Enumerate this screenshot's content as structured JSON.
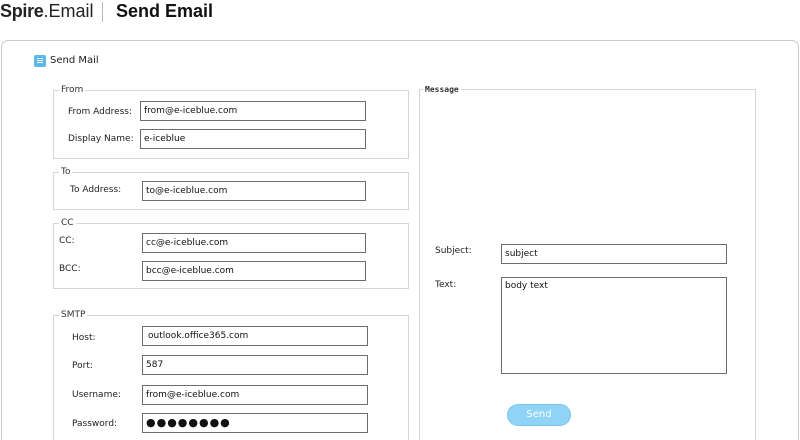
{
  "header": {
    "brand_strong": "Spire",
    "brand_suffix": ".Email",
    "title": "Send Email"
  },
  "panel": {
    "title": "Send Mail",
    "icon": "email-app-icon"
  },
  "from_group": {
    "legend": "From",
    "from_address_label": "From Address:",
    "from_address_value": "from@e-iceblue.com",
    "display_name_label": "Display Name:",
    "display_name_value": "e-iceblue"
  },
  "to_group": {
    "legend": "To",
    "to_address_label": "To Address:",
    "to_address_value": "to@e-iceblue.com"
  },
  "cc_group": {
    "legend": "CC",
    "cc_label": "CC:",
    "cc_value": "cc@e-iceblue.com",
    "bcc_label": "BCC:",
    "bcc_value": "bcc@e-iceblue.com"
  },
  "smtp_group": {
    "legend": "SMTP",
    "host_label": "Host:",
    "host_value": "outlook.office365.com",
    "port_label": "Port:",
    "port_value": "587",
    "username_label": "Username:",
    "username_value": "from@e-iceblue.com",
    "password_label": "Password:",
    "password_value": "●●●●●●●●"
  },
  "message_group": {
    "legend": "Message",
    "subject_label": "Subject:",
    "subject_value": "subject",
    "text_label": "Text:",
    "text_value": "body text",
    "send_label": "Send"
  },
  "colors": {
    "send_button": "#8fd3f7",
    "icon_blue": "#5bb8e8",
    "border": "#c9c9c9"
  }
}
